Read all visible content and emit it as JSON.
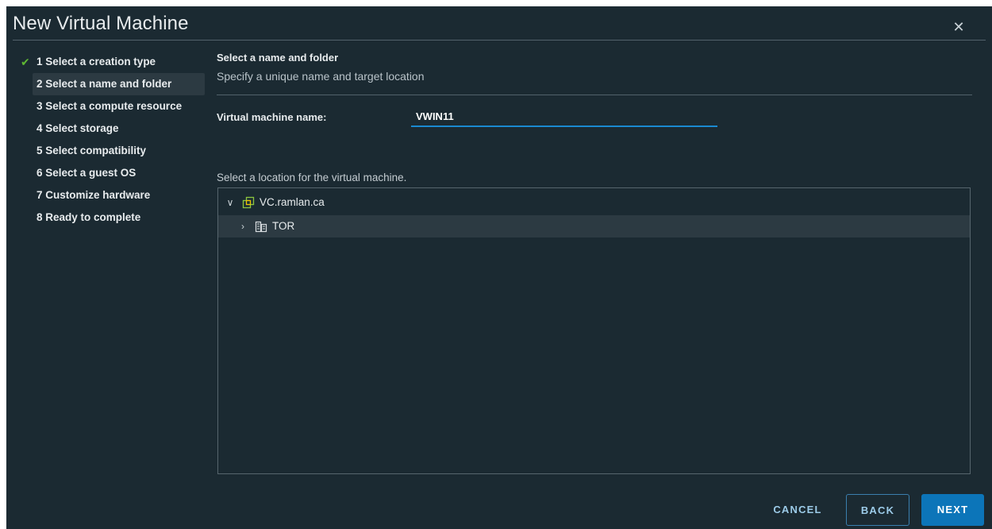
{
  "dialog": {
    "title": "New Virtual Machine",
    "close_icon": "close-icon"
  },
  "steps": [
    {
      "label": "1 Select a creation type",
      "state": "completed"
    },
    {
      "label": "2 Select a name and folder",
      "state": "active"
    },
    {
      "label": "3 Select a compute resource",
      "state": "pending"
    },
    {
      "label": "4 Select storage",
      "state": "pending"
    },
    {
      "label": "5 Select compatibility",
      "state": "pending"
    },
    {
      "label": "6 Select a guest OS",
      "state": "pending"
    },
    {
      "label": "7 Customize hardware",
      "state": "pending"
    },
    {
      "label": "8 Ready to complete",
      "state": "pending"
    }
  ],
  "main": {
    "section_title": "Select a name and folder",
    "section_subtitle": "Specify a unique name and target location",
    "vm_name_label": "Virtual machine name:",
    "vm_name_value": "VWIN11",
    "location_label": "Select a location for the virtual machine.",
    "tree": [
      {
        "label": "VC.ramlan.ca",
        "expanded": true,
        "icon": "vcenter-icon",
        "level": 0
      },
      {
        "label": "TOR",
        "expanded": false,
        "icon": "datacenter-icon",
        "level": 1
      }
    ]
  },
  "buttons": {
    "cancel": "CANCEL",
    "back": "BACK",
    "next": "NEXT"
  },
  "colors": {
    "background": "#1b2a32",
    "accent": "#0c75b9",
    "check": "#5fb833",
    "input_underline": "#1a8ad1"
  }
}
